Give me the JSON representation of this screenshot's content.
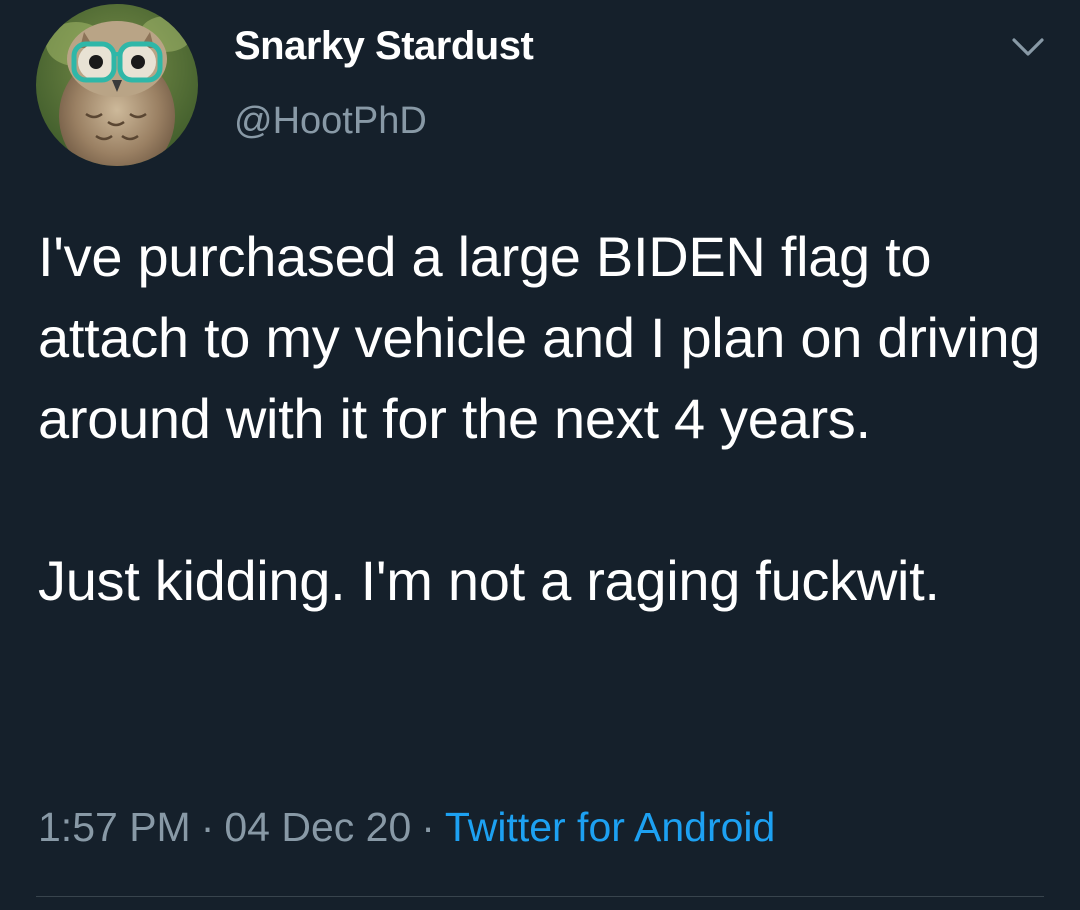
{
  "tweet": {
    "display_name": "Snarky Stardust",
    "handle": "@HootPhD",
    "avatar_icon": "owl-with-glasses-avatar",
    "menu_icon": "chevron-down-icon",
    "body": [
      "I've purchased a large BIDEN flag to attach to my vehicle and I plan on driving around with it for the next 4 years.",
      "Just kidding. I'm not a raging fuckwit."
    ],
    "time": "1:57 PM",
    "separator": "·",
    "date": "04 Dec 20",
    "source": "Twitter for Android"
  },
  "colors": {
    "background": "#15202b",
    "primary_text": "#ffffff",
    "secondary_text": "#8899a6",
    "link": "#1da1f2",
    "divider": "#38444d"
  }
}
